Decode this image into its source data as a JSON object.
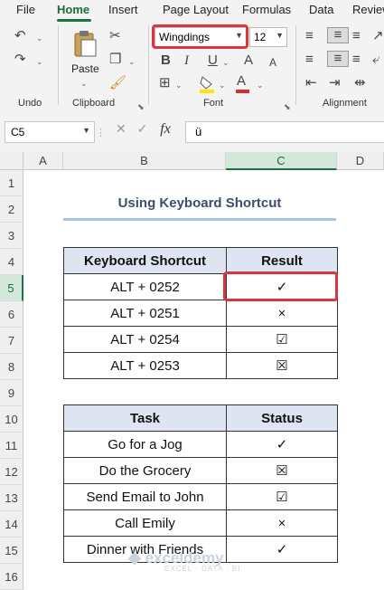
{
  "menu_tabs": [
    "File",
    "Home",
    "Insert",
    "Page Layout",
    "Formulas",
    "Data",
    "Review"
  ],
  "ribbon": {
    "groups": {
      "undo": "Undo",
      "clipboard": "Clipboard",
      "font": "Font",
      "alignment": "Alignment"
    },
    "paste_label": "Paste",
    "font_name": "Wingdings",
    "font_size": "12",
    "bold": "B",
    "italic": "I",
    "underline": "U",
    "grow_font": "A",
    "shrink_font": "A",
    "font_color_letter": "A"
  },
  "formula_bar": {
    "name_box": "C5",
    "fx": "fx",
    "value": "ü"
  },
  "columns": [
    "A",
    "B",
    "C",
    "D"
  ],
  "rows": [
    "1",
    "2",
    "3",
    "4",
    "5",
    "6",
    "7",
    "8",
    "9",
    "10",
    "11",
    "12",
    "13",
    "14",
    "15",
    "16"
  ],
  "sheet": {
    "title": "Using Keyboard Shortcut",
    "table1": {
      "headers": [
        "Keyboard Shortcut",
        "Result"
      ],
      "rows": [
        [
          "ALT + 0252",
          "✓"
        ],
        [
          "ALT + 0251",
          "✕"
        ],
        [
          "ALT + 0254",
          "☑"
        ],
        [
          "ALT + 0253",
          "☒"
        ]
      ]
    },
    "table2": {
      "headers": [
        "Task",
        "Status"
      ],
      "rows": [
        [
          "Go for a Jog",
          "✓"
        ],
        [
          "Do the Grocery",
          "☒"
        ],
        [
          "Send Email to John",
          "☑"
        ],
        [
          "Call Emily",
          "✕"
        ],
        [
          "Dinner with Friends",
          "✓"
        ]
      ]
    }
  },
  "watermark": {
    "name": "exceldemy",
    "tagline": "EXCEL · DATA · BI"
  },
  "colors": {
    "accent": "#1e7145",
    "highlight": "#d9363e",
    "header_fill": "#dfe4f3",
    "title_text": "#3b4f6b"
  }
}
